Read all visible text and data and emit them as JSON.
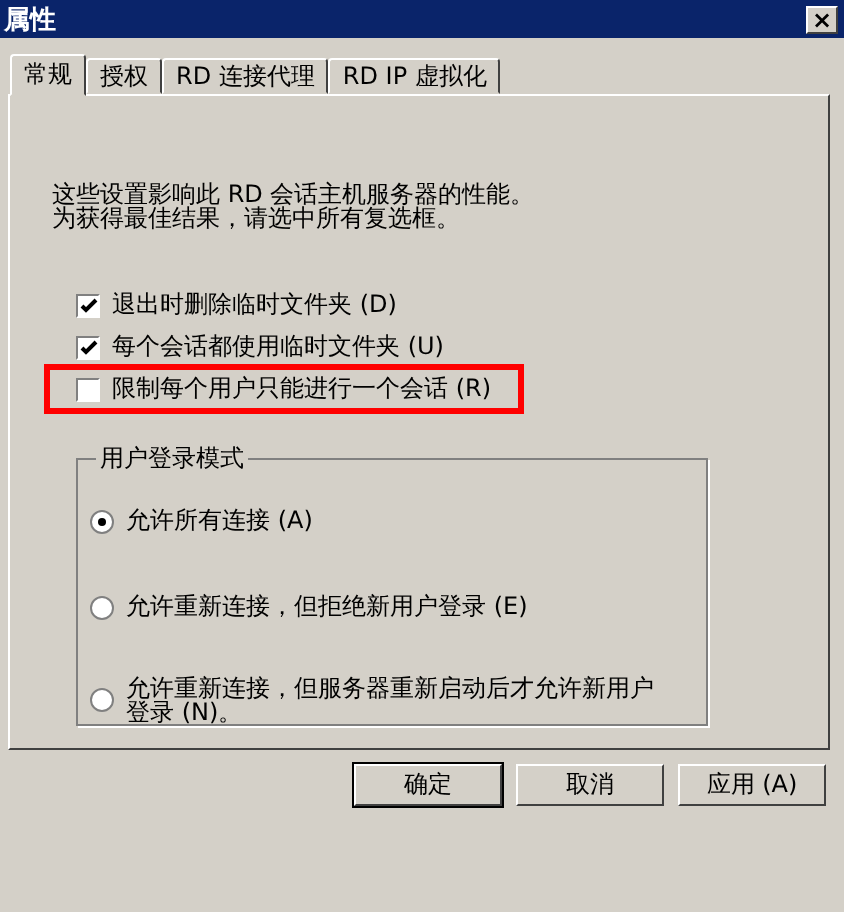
{
  "window": {
    "title": "属性",
    "close": "×"
  },
  "tabs": [
    {
      "label": "常规",
      "selected": true
    },
    {
      "label": "授权",
      "selected": false
    },
    {
      "label": "RD 连接代理",
      "selected": false
    },
    {
      "label": "RD IP 虚拟化",
      "selected": false
    }
  ],
  "description": [
    "这些设置影响此 RD 会话主机服务器的性能。",
    "为获得最佳结果，请选中所有复选框。"
  ],
  "checkboxes": [
    {
      "label": "退出时删除临时文件夹 (D)",
      "checked": true,
      "highlighted": false
    },
    {
      "label": "每个会话都使用临时文件夹 (U)",
      "checked": true,
      "highlighted": false
    },
    {
      "label": "限制每个用户只能进行一个会话 (R)",
      "checked": false,
      "highlighted": true
    }
  ],
  "login_mode": {
    "title": "用户登录模式",
    "options": [
      {
        "label": "允许所有连接 (A)",
        "selected": true
      },
      {
        "label": "允许重新连接，但拒绝新用户登录 (E)",
        "selected": false
      },
      {
        "label": "允许重新连接，但服务器重新启动后才允许新用户登录 (N)。",
        "selected": false
      }
    ]
  },
  "buttons": [
    {
      "label": "确定",
      "default": true
    },
    {
      "label": "取消",
      "default": false
    },
    {
      "label": "应用 (A)",
      "default": false
    }
  ]
}
